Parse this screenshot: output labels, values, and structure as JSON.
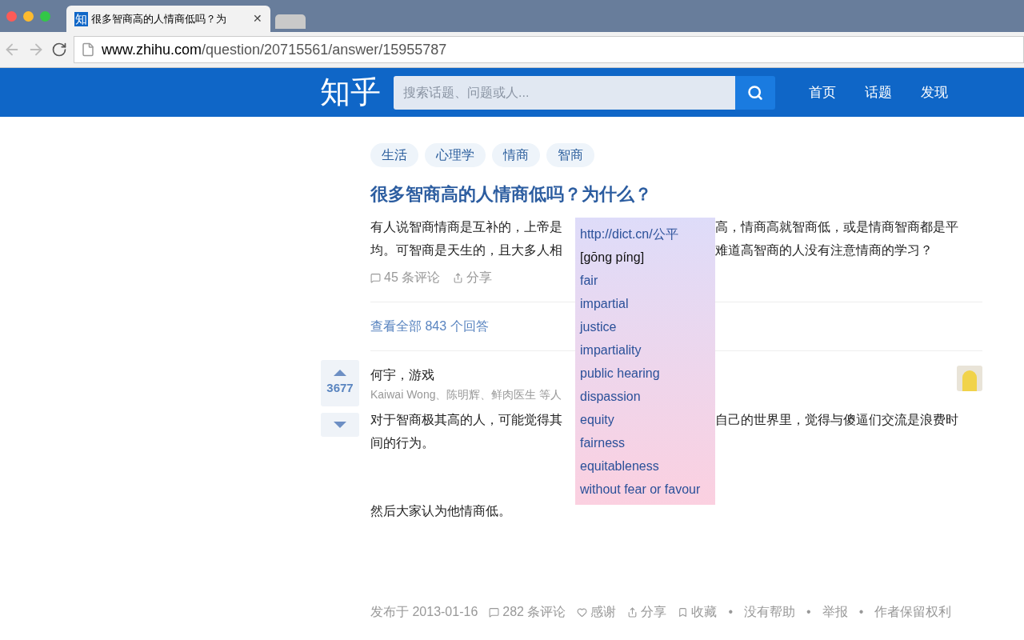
{
  "browser": {
    "tab": {
      "icon_text": "知",
      "title": "很多智商高的人情商低吗？为",
      "close": "✕",
      "selected": true
    },
    "url_host": "www.zhihu.com",
    "url_path": "/question/20715561/answer/15955787"
  },
  "header": {
    "logo": "知乎",
    "search": {
      "placeholder": "搜索话题、问题或人..."
    },
    "nav": [
      "首页",
      "话题",
      "发现"
    ]
  },
  "question": {
    "topics": [
      "生活",
      "心理学",
      "情商",
      "智商"
    ],
    "title": "很多智商高的人情商低吗？为什么？",
    "detail_lines": [
      {
        "left": "有人说智商情商是互补的，上帝是",
        "right": "高，情商高就智商低，或是情商智商都是平"
      },
      {
        "left": "均。可智商是天生的，且大多人相",
        "right": "难道高智商的人没有注意情商的学习？"
      }
    ],
    "comments": "45 条评论",
    "share": "分享",
    "all_answers": "查看全部 843 个回答"
  },
  "answer": {
    "votes": "3677",
    "author": "何宇，游戏",
    "voters": "Kaiwai Wong、陈明辉、鲜肉医生 等人",
    "paragraph_lines": [
      {
        "left": "对于智商极其高的人，可能觉得其",
        "right": "自己的世界里，觉得与傻逼们交流是浪费时"
      },
      {
        "left": "间的行为。"
      }
    ],
    "last_paragraph": "然后大家认为他情商低。",
    "footer": {
      "published": "发布于 2013-01-16",
      "comments": "282 条评论",
      "thanks": "感谢",
      "share": "分享",
      "collect": "收藏",
      "separator": "•",
      "links": [
        "没有帮助",
        "举报",
        "作者保留权利"
      ]
    }
  },
  "dict_popup": {
    "link": "http://dict.cn/公平",
    "pinyin": "[gōng píng]",
    "meanings": [
      "fair",
      "impartial",
      "justice",
      "impartiality",
      "public hearing",
      "dispassion",
      "equity",
      "fairness",
      "equitableness",
      "without fear or favour"
    ]
  }
}
